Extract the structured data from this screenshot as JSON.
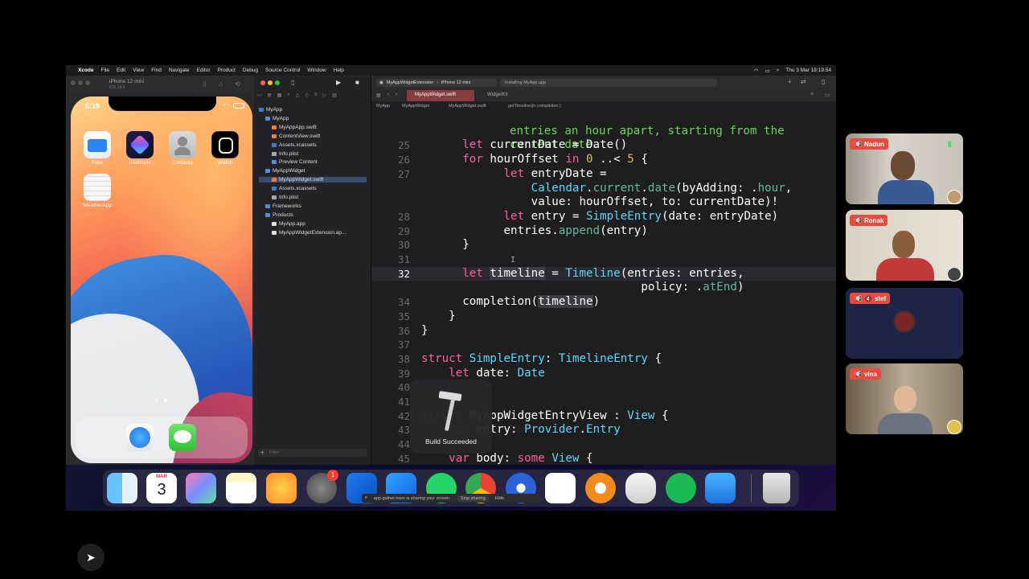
{
  "menubar": {
    "app_name": "Xcode",
    "items": [
      "File",
      "Edit",
      "View",
      "Find",
      "Navigate",
      "Editor",
      "Product",
      "Debug",
      "Source Control",
      "Window",
      "Help"
    ],
    "datetime": "Thu 3 Mar  18:19:54"
  },
  "simulator": {
    "device_title": "iPhone 12 mini",
    "subtitle": "iOS 14.5",
    "phone_time": "6:19",
    "apps": [
      {
        "label": "Files",
        "icon": "files-icon"
      },
      {
        "label": "Shortcuts",
        "icon": "shortcuts-icon"
      },
      {
        "label": "Contacts",
        "icon": "contacts-icon"
      },
      {
        "label": "Watch",
        "icon": "watch-icon"
      },
      {
        "label": "WeatherApp",
        "icon": "weatherapp-icon"
      }
    ],
    "dock_apps": [
      "safari-icon",
      "messages-icon"
    ]
  },
  "xcode": {
    "scheme": "MyAppWidgetExtension",
    "destination": "iPhone 12 mini",
    "status": "Installing MyApp.app",
    "tab_active": "MyAppWidget.swift",
    "tab_other": "WidgetKit",
    "jumpbar": [
      "MyApp",
      "MyAppWidget",
      "MyAppWidget.swift",
      "getTimeline(in:completion:)"
    ],
    "navigator": [
      {
        "label": "MyApp",
        "indent": 0,
        "kind": "project"
      },
      {
        "label": "MyApp",
        "indent": 1,
        "kind": "folder"
      },
      {
        "label": "MyAppApp.swift",
        "indent": 2,
        "kind": "file"
      },
      {
        "label": "ContentView.swift",
        "indent": 2,
        "kind": "file"
      },
      {
        "label": "Assets.xcassets",
        "indent": 2,
        "kind": "asset"
      },
      {
        "label": "Info.plist",
        "indent": 2,
        "kind": "plist"
      },
      {
        "label": "Preview Content",
        "indent": 2,
        "kind": "folder"
      },
      {
        "label": "MyAppWidget",
        "indent": 1,
        "kind": "folder"
      },
      {
        "label": "MyAppWidget.swift",
        "indent": 2,
        "kind": "file",
        "selected": true
      },
      {
        "label": "Assets.xcassets",
        "indent": 2,
        "kind": "asset"
      },
      {
        "label": "Info.plist",
        "indent": 2,
        "kind": "plist"
      },
      {
        "label": "Frameworks",
        "indent": 1,
        "kind": "folder"
      },
      {
        "label": "Products",
        "indent": 1,
        "kind": "folder"
      },
      {
        "label": "MyApp.app",
        "indent": 2,
        "kind": "app"
      },
      {
        "label": "MyAppWidgetExtension.ap...",
        "indent": 2,
        "kind": "app"
      }
    ],
    "filter_placeholder": "Filter",
    "build_status": "Build Succeeded"
  },
  "code": {
    "comment_line1": "entries an hour apart, starting from the",
    "comment_line2": "current date.",
    "lines": [
      {
        "n": "25"
      },
      {
        "n": "26"
      },
      {
        "n": "27"
      },
      {
        "n": ""
      },
      {
        "n": "28"
      },
      {
        "n": "29"
      },
      {
        "n": "30"
      },
      {
        "n": "31"
      },
      {
        "n": "32"
      },
      {
        "n": ""
      },
      {
        "n": "34"
      },
      {
        "n": "35"
      },
      {
        "n": "36"
      },
      {
        "n": "37"
      },
      {
        "n": "38"
      },
      {
        "n": "39"
      },
      {
        "n": "40"
      },
      {
        "n": "41"
      },
      {
        "n": "42"
      },
      {
        "n": "43"
      },
      {
        "n": "44"
      },
      {
        "n": "45"
      }
    ]
  },
  "screen_share": {
    "text": "app.gather.town is sharing your screen.",
    "stop": "Stop sharing",
    "hide": "Hide"
  },
  "dock": {
    "calendar_month": "MAR",
    "calendar_day": "3",
    "badge": "1"
  },
  "participants": [
    {
      "name": "Nadun",
      "muted": false
    },
    {
      "name": "Ronak",
      "muted": false
    },
    {
      "name": "stef",
      "muted": true
    },
    {
      "name": "vina",
      "muted": false
    }
  ],
  "colors": {
    "keyword": "#fc5fa3",
    "type": "#5dd8ff",
    "comment": "#6bd55b",
    "tag": "#e94a3f"
  }
}
